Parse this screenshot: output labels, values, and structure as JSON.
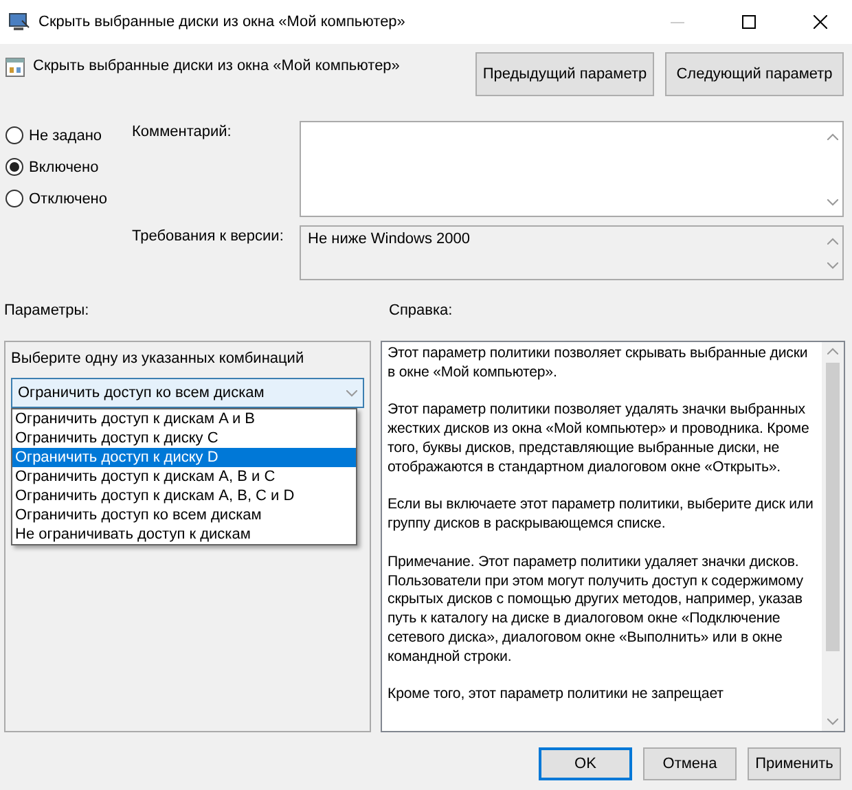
{
  "window": {
    "title": "Скрыть выбранные диски из окна «Мой компьютер»"
  },
  "policy": {
    "name": "Скрыть выбранные диски из окна «Мой компьютер»"
  },
  "nav_buttons": [
    "Предыдущий параметр",
    "Следующий параметр"
  ],
  "states": [
    {
      "label": "Не задано",
      "selected": false
    },
    {
      "label": "Включено",
      "selected": true
    },
    {
      "label": "Отключено",
      "selected": false
    }
  ],
  "comment": {
    "label": "Комментарий:"
  },
  "requirements": {
    "label": "Требования к версии:",
    "value": "Не ниже Windows 2000"
  },
  "options": {
    "label": "Параметры:",
    "prompt": "Выберите одну из указанных комбинаций",
    "dropdown": {
      "value": "Ограничить доступ ко всем дискам",
      "expanded": true,
      "items": [
        {
          "label": "Ограничить доступ к дискам A и B",
          "highlighted": false
        },
        {
          "label": "Ограничить доступ к диску C",
          "highlighted": false
        },
        {
          "label": "Ограничить доступ к диску D",
          "highlighted": true
        },
        {
          "label": "Ограничить доступ к дискам A, B и C",
          "highlighted": false
        },
        {
          "label": "Ограничить доступ к дискам A, B, C и D",
          "highlighted": false
        },
        {
          "label": "Ограничить доступ ко всем дискам",
          "highlighted": false
        },
        {
          "label": "Не ограничивать доступ к дискам",
          "highlighted": false
        }
      ]
    }
  },
  "help": {
    "label": "Справка:",
    "paragraphs": [
      "Этот параметр политики позволяет скрывать выбранные диски в окне «Мой компьютер».",
      "Этот параметр политики позволяет удалять значки выбранных жестких дисков из окна «Мой компьютер» и проводника. Кроме того, буквы дисков, представляющие выбранные диски, не отображаются в стандартном диалоговом окне «Открыть».",
      "Если вы включаете этот параметр политики, выберите диск или группу дисков в раскрывающемся списке.",
      "Примечание. Этот параметр политики удаляет значки дисков. Пользователи при этом могут получить доступ к содержимому скрытых дисков с помощью других методов, например, указав путь к каталогу на диске в диалоговом окне «Подключение сетевого диска», диалоговом окне «Выполнить» или в окне командной строки.",
      "Кроме того, этот параметр политики не запрещает"
    ]
  },
  "buttons": [
    {
      "label": "OK",
      "default": true
    },
    {
      "label": "Отмена",
      "default": false
    },
    {
      "label": "Применить",
      "default": false
    }
  ]
}
